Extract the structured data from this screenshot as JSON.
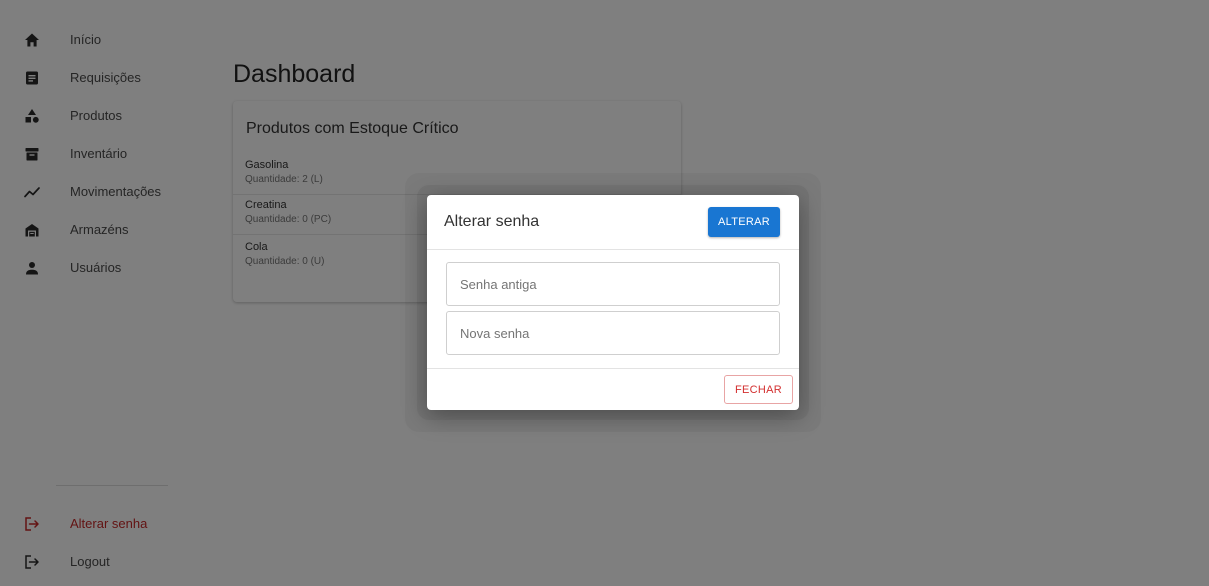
{
  "sidebar": {
    "items": [
      {
        "label": "Início",
        "icon": "home-icon"
      },
      {
        "label": "Requisições",
        "icon": "document-icon"
      },
      {
        "label": "Produtos",
        "icon": "shapes-icon"
      },
      {
        "label": "Inventário",
        "icon": "archive-icon"
      },
      {
        "label": "Movimentações",
        "icon": "trending-icon"
      },
      {
        "label": "Armazéns",
        "icon": "warehouse-icon"
      },
      {
        "label": "Usuários",
        "icon": "user-icon"
      }
    ],
    "bottom": [
      {
        "label": "Alterar senha",
        "icon": "logout-icon"
      },
      {
        "label": "Logout",
        "icon": "logout-icon"
      }
    ]
  },
  "main": {
    "title": "Dashboard",
    "card": {
      "title": "Produtos com Estoque Crítico",
      "items": [
        {
          "name": "Gasolina",
          "quantity": "Quantidade: 2 (L)"
        },
        {
          "name": "Creatina",
          "quantity": "Quantidade: 0 (PC)"
        },
        {
          "name": "Cola",
          "quantity": "Quantidade: 0 (U)"
        }
      ]
    }
  },
  "modal": {
    "title": "Alterar senha",
    "submit_label": "ALTERAR",
    "old_password_placeholder": "Senha antiga",
    "new_password_placeholder": "Nova senha",
    "close_label": "FECHAR"
  },
  "colors": {
    "primary": "#1976d2",
    "danger": "#d32f2f",
    "icon": "#2b2b2b"
  }
}
